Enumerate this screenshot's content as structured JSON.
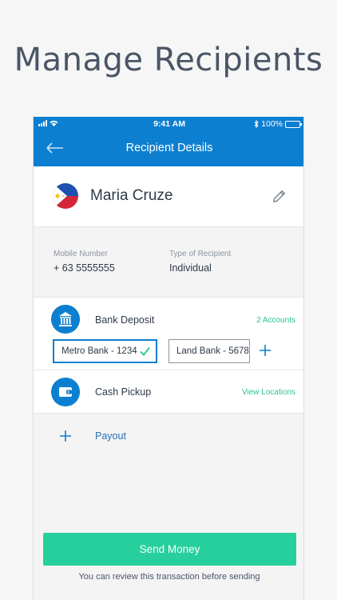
{
  "headline": "Manage Recipients",
  "status_bar": {
    "time": "9:41 AM",
    "battery": "100%"
  },
  "nav": {
    "title": "Recipient Details"
  },
  "recipient": {
    "name": "Maria Cruze",
    "mobile_label": "Mobile Number",
    "mobile_value": "+ 63 5555555",
    "type_label": "Type of Recipient",
    "type_value": "Individual"
  },
  "bank_deposit": {
    "label": "Bank Deposit",
    "link": "2 Accounts",
    "accounts": [
      {
        "label": "Metro Bank - 1234",
        "selected": true
      },
      {
        "label": "Land Bank - 5678",
        "selected": false
      }
    ]
  },
  "cash_pickup": {
    "label": "Cash Pickup",
    "link": "View Locations"
  },
  "payout": {
    "label": "Payout"
  },
  "send_button": "Send Money",
  "review_note": "You can review this transaction before sending",
  "colors": {
    "primary": "#0d7fd0",
    "accent": "#26cf9c",
    "link_green": "#2ac29a"
  },
  "icons": [
    "signal-icon",
    "wifi-icon",
    "bluetooth-icon",
    "battery-icon",
    "back-arrow-icon",
    "philippines-flag-icon",
    "pencil-edit-icon",
    "bank-icon",
    "checkmark-icon",
    "plus-icon",
    "wallet-icon"
  ]
}
